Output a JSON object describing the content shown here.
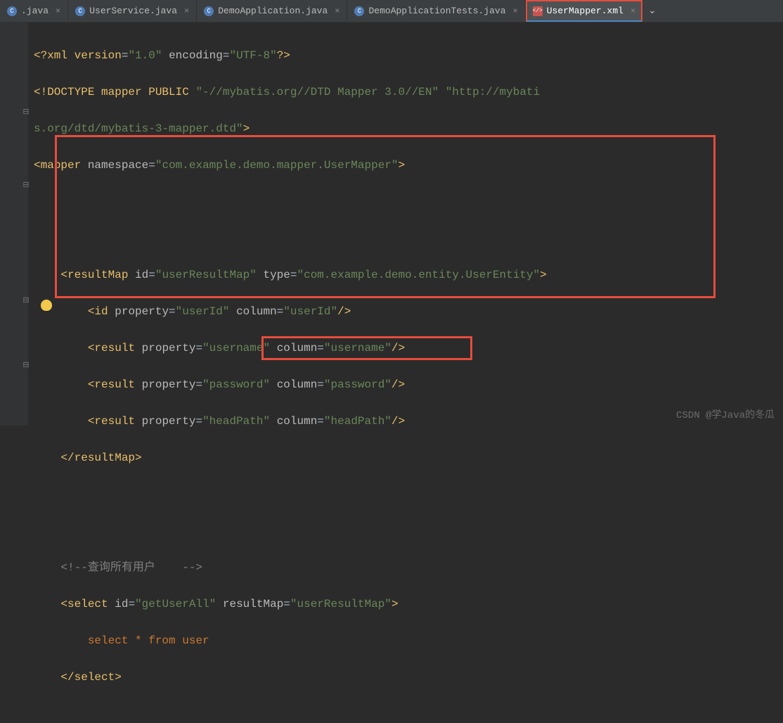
{
  "tabs": [
    {
      "label": ".java",
      "type": "java"
    },
    {
      "label": "UserService.java",
      "type": "java"
    },
    {
      "label": "DemoApplication.java",
      "type": "java"
    },
    {
      "label": "DemoApplicationTests.java",
      "type": "java"
    },
    {
      "label": "UserMapper.xml",
      "type": "xml",
      "active": true,
      "highlighted": true
    }
  ],
  "code": {
    "xml_decl1": "<?",
    "xml_decl2": "xml version",
    "xml_ver": "\"1.0\"",
    "xml_enc_attr": "encoding",
    "xml_enc_val": "\"UTF-8\"",
    "xml_decl3": "?>",
    "doctype1": "<!DOCTYPE mapper PUBLIC ",
    "doctype2": "\"-//mybatis.org//DTD Mapper 3.0//EN\"",
    "doctype3": " \"http://mybati",
    "doctype4": "s.org/dtd/mybatis-3-mapper.dtd\"",
    "doctype5": ">",
    "mapper_open": "<",
    "mapper_tag": "mapper ",
    "ns_attr": "namespace",
    "ns_val": "\"com.example.demo.mapper.UserMapper\"",
    "gt": ">",
    "rm_tag": "resultMap ",
    "rm_id_attr": "id",
    "rm_id_val": "\"userResultMap\"",
    "rm_type_attr": "type",
    "rm_type_val": "\"com.example.demo.entity.UserEntity\"",
    "id_tag": "id ",
    "prop_attr": "property",
    "col_attr": "column",
    "userId": "\"userId\"",
    "result_tag": "result ",
    "username": "\"username\"",
    "password": "\"password\"",
    "headPath": "\"headPath\"",
    "rm_close": "</",
    "rm_close2": "resultMap",
    "comment": "<!--查询所有用户    -->",
    "select_tag": "select ",
    "select_id": "\"getUserAll\"",
    "resultMap_attr": "resultMap",
    "resultMap_val": "\"userResultMap\"",
    "sql": "select * from user",
    "select_close": "select",
    "slash_gt": "/>"
  },
  "watermark": "CSDN @学Java的冬瓜"
}
